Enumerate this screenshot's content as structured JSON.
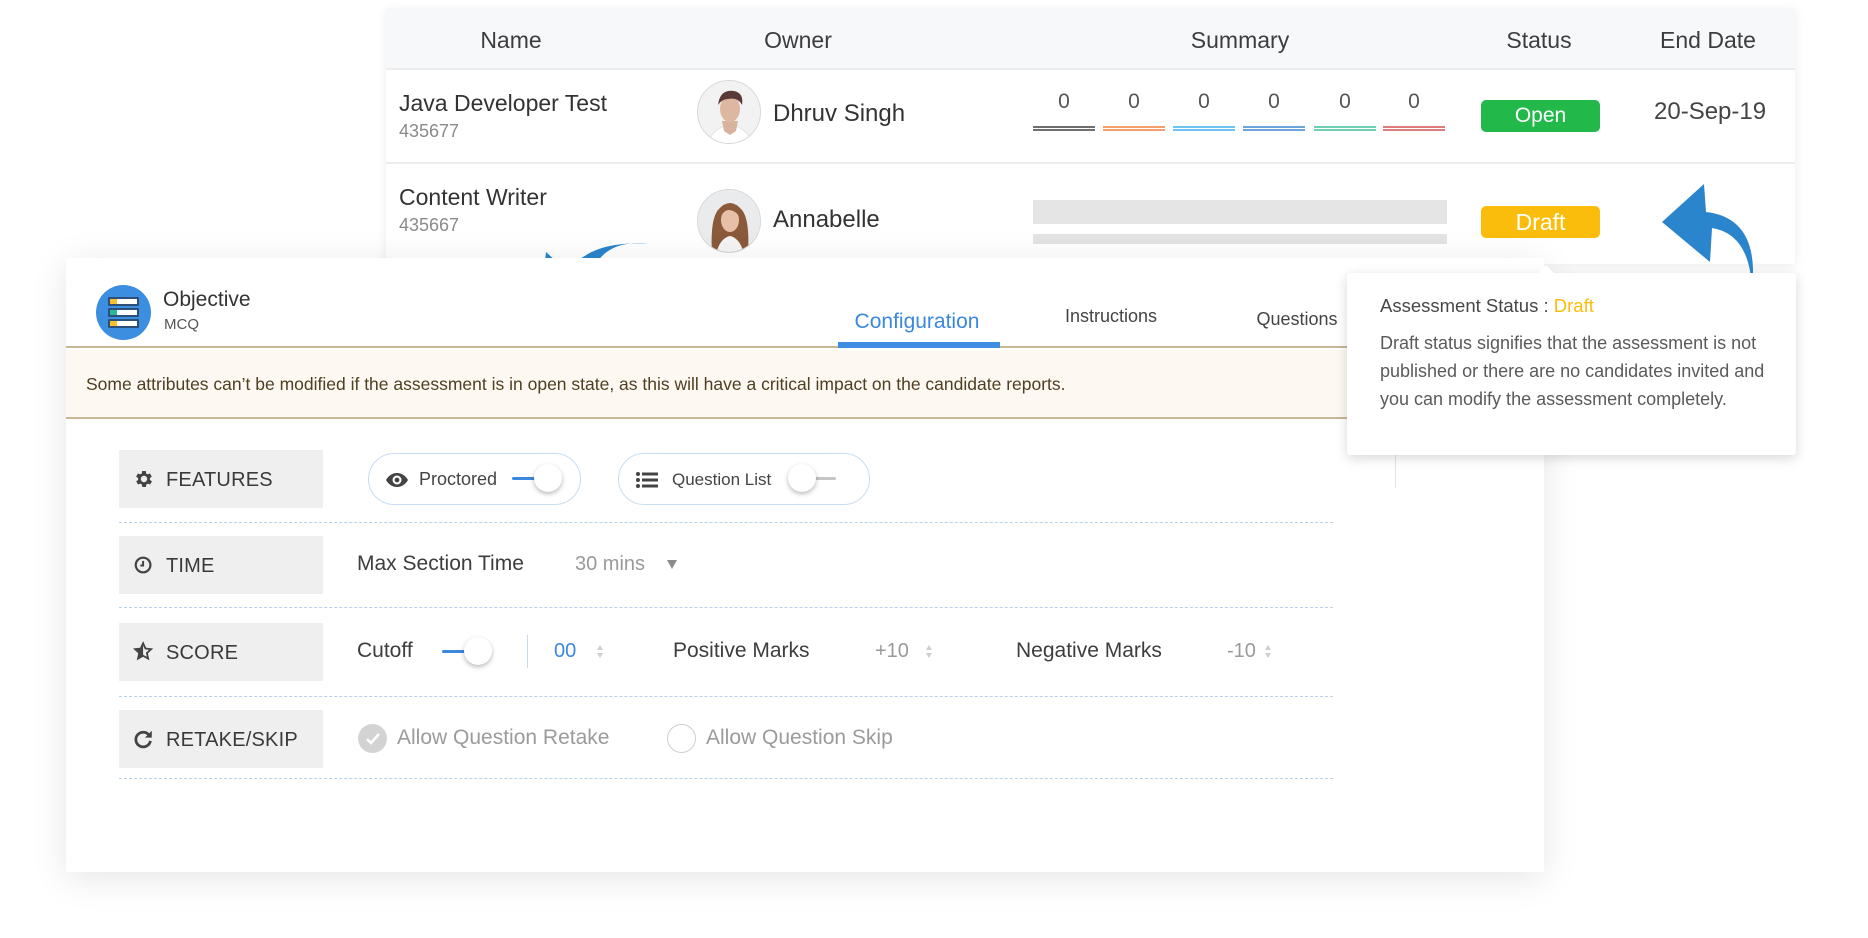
{
  "table": {
    "columns": [
      "Name",
      "Owner",
      "Summary",
      "Status",
      "End Date"
    ],
    "rows": [
      {
        "name": "Java Developer Test",
        "id": "435677",
        "owner": "Dhruv Singh",
        "summary": [
          "0",
          "0",
          "0",
          "0",
          "0",
          "0"
        ],
        "status": "Open",
        "end_date": "20-Sep-19"
      },
      {
        "name": "Content Writer",
        "id": "435667",
        "owner": "Annabelle",
        "summary_loading": true,
        "status": "Draft",
        "end_date": ""
      }
    ],
    "summary_colors": [
      "#6f6f6f",
      "#f4a06a",
      "#6ec3f2",
      "#6ea4dc",
      "#6fd0b4",
      "#dd7c7c"
    ]
  },
  "panel": {
    "title": "Objective",
    "subtitle": "MCQ",
    "tabs": [
      {
        "label": "Configuration",
        "active": true
      },
      {
        "label": "Instructions",
        "active": false
      },
      {
        "label": "Questions",
        "active": false
      }
    ],
    "banner": "Some attributes can’t be modified if the assessment is in open state, as this will have a critical impact on the candidate reports.",
    "sections": {
      "features": {
        "label": "FEATURES",
        "icon": "gear-icon",
        "proctored": {
          "label": "Proctored",
          "icon": "eye-icon",
          "enabled": true
        },
        "question_list": {
          "label": "Question List",
          "icon": "list-icon",
          "enabled": false
        }
      },
      "time": {
        "label": "TIME",
        "icon": "clock-icon",
        "max_section_time_label": "Max Section Time",
        "max_section_time_value": "30 mins"
      },
      "score": {
        "label": "SCORE",
        "icon": "star-icon",
        "cutoff_label": "Cutoff",
        "cutoff_enabled": true,
        "cutoff_value": "00",
        "positive_label": "Positive Marks",
        "positive_value": "+10",
        "negative_label": "Negative Marks",
        "negative_value": "-10"
      },
      "retake": {
        "label": "RETAKE/SKIP",
        "icon": "refresh-icon",
        "allow_retake_label": "Allow Question Retake",
        "allow_retake_checked": true,
        "allow_skip_label": "Allow Question Skip",
        "allow_skip_checked": false
      }
    }
  },
  "tooltip": {
    "title_prefix": "Assessment Status :",
    "title_status": "Draft",
    "body": "Draft status signifies that the assessment is not published or there are no candidates invited and you can modify the assessment completely."
  },
  "colors": {
    "accent": "#3a88df",
    "open": "#22b94a",
    "draft": "#fbbd0c",
    "arrow": "#2a85cc",
    "banner_bg": "#fdf9f2"
  }
}
